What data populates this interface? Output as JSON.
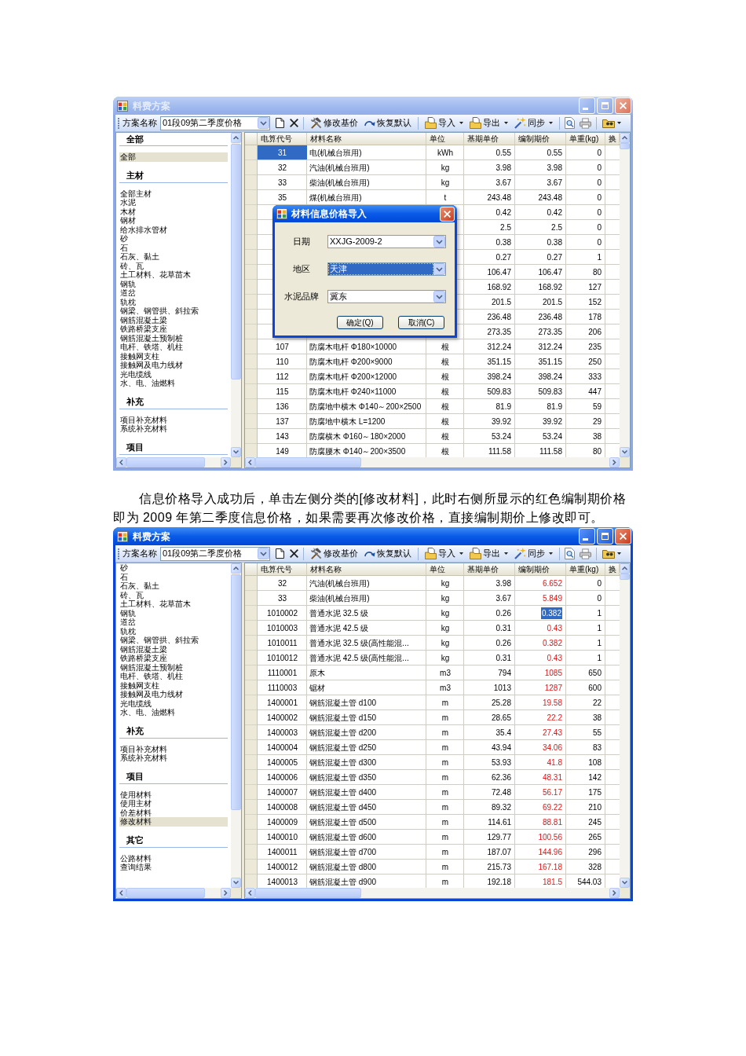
{
  "blocks": [
    {
      "kind": "window",
      "title": "料费方案",
      "active": false,
      "toolbar": {
        "label": "方案名称",
        "scheme": "01段09第二季度价格",
        "buttons": [
          {
            "label": "修改基价",
            "dropdown": false
          },
          {
            "label": "恢复默认",
            "dropdown": false
          },
          {
            "label": "导入",
            "dropdown": true
          },
          {
            "label": "导出",
            "dropdown": true
          },
          {
            "label": "同步",
            "dropdown": true
          }
        ]
      },
      "sidebar": {
        "sections": [
          {
            "title": "全部",
            "items": [
              {
                "label": "全部",
                "selected": true
              }
            ]
          },
          {
            "title": "主材",
            "items": [
              {
                "label": "全部主材",
                "selected": false
              },
              {
                "label": "水泥",
                "selected": false
              },
              {
                "label": "木材",
                "selected": false
              },
              {
                "label": "钢材",
                "selected": false
              },
              {
                "label": "给水排水管材",
                "selected": false
              },
              {
                "label": "砂",
                "selected": false
              },
              {
                "label": "石",
                "selected": false
              },
              {
                "label": "石灰、黏土",
                "selected": false
              },
              {
                "label": "砖、瓦",
                "selected": false
              },
              {
                "label": "土工材料、花草苗木",
                "selected": false
              },
              {
                "label": "钢轨",
                "selected": false
              },
              {
                "label": "道岔",
                "selected": false
              },
              {
                "label": "轨枕",
                "selected": false
              },
              {
                "label": "钢梁、钢管拱、斜拉索",
                "selected": false
              },
              {
                "label": "钢筋混凝土梁",
                "selected": false
              },
              {
                "label": "铁路桥梁支座",
                "selected": false
              },
              {
                "label": "钢筋混凝土预制桩",
                "selected": false
              },
              {
                "label": "电杆、铁塔、机柱",
                "selected": false
              },
              {
                "label": "接触网支柱",
                "selected": false
              },
              {
                "label": "接触网及电力线材",
                "selected": false
              },
              {
                "label": "光电缆线",
                "selected": false
              },
              {
                "label": "水、电、油燃料",
                "selected": false
              }
            ]
          },
          {
            "title": "补充",
            "items": [
              {
                "label": "项目补充材料",
                "selected": false
              },
              {
                "label": "系统补充材料",
                "selected": false
              }
            ]
          },
          {
            "title": "项目"
          }
        ]
      },
      "table": {
        "columns": [
          "电算代号",
          "材料名称",
          "单位",
          "基期单价",
          "编制期价",
          "单重(kg)",
          "换"
        ],
        "editing": false,
        "rows": [
          {
            "code": "31",
            "name": "电(机械台班用)",
            "unit": "kWh",
            "base_price": "0.55",
            "current_price": "0.55",
            "unit_weight": "0",
            "modified": false,
            "code_selected": true,
            "price_selected": false
          },
          {
            "code": "32",
            "name": "汽油(机械台班用)",
            "unit": "kg",
            "base_price": "3.98",
            "current_price": "3.98",
            "unit_weight": "0",
            "modified": false,
            "code_selected": false,
            "price_selected": false
          },
          {
            "code": "33",
            "name": "柴油(机械台班用)",
            "unit": "kg",
            "base_price": "3.67",
            "current_price": "3.67",
            "unit_weight": "0",
            "modified": false,
            "code_selected": false,
            "price_selected": false
          },
          {
            "code": "35",
            "name": "煤(机械台班用)",
            "unit": "t",
            "base_price": "243.48",
            "current_price": "243.48",
            "unit_weight": "0",
            "modified": false,
            "code_selected": false,
            "price_selected": false
          },
          {
            "base_price": "0.42",
            "current_price": "0.42",
            "unit_weight": "0",
            "modified": false,
            "code_selected": false,
            "price_selected": false
          },
          {
            "base_price": "2.5",
            "current_price": "2.5",
            "unit_weight": "0",
            "modified": false,
            "code_selected": false,
            "price_selected": false
          },
          {
            "base_price": "0.38",
            "current_price": "0.38",
            "unit_weight": "0",
            "modified": false,
            "code_selected": false,
            "price_selected": false
          },
          {
            "base_price": "0.27",
            "current_price": "0.27",
            "unit_weight": "1",
            "modified": false,
            "code_selected": false,
            "price_selected": false
          },
          {
            "base_price": "106.47",
            "current_price": "106.47",
            "unit_weight": "80",
            "modified": false,
            "code_selected": false,
            "price_selected": false
          },
          {
            "base_price": "168.92",
            "current_price": "168.92",
            "unit_weight": "127",
            "modified": false,
            "code_selected": false,
            "price_selected": false
          },
          {
            "base_price": "201.5",
            "current_price": "201.5",
            "unit_weight": "152",
            "modified": false,
            "code_selected": false,
            "price_selected": false
          },
          {
            "base_price": "236.48",
            "current_price": "236.48",
            "unit_weight": "178",
            "modified": false,
            "code_selected": false,
            "price_selected": false
          },
          {
            "base_price": "273.35",
            "current_price": "273.35",
            "unit_weight": "206",
            "modified": false,
            "code_selected": false,
            "price_selected": false
          },
          {
            "code": "107",
            "name": "防腐木电杆 Φ180×10000",
            "unit": "根",
            "base_price": "312.24",
            "current_price": "312.24",
            "unit_weight": "235",
            "modified": false,
            "code_selected": false,
            "price_selected": false
          },
          {
            "code": "110",
            "name": "防腐木电杆 Φ200×9000",
            "unit": "根",
            "base_price": "351.15",
            "current_price": "351.15",
            "unit_weight": "250",
            "modified": false,
            "code_selected": false,
            "price_selected": false
          },
          {
            "code": "112",
            "name": "防腐木电杆 Φ200×12000",
            "unit": "根",
            "base_price": "398.24",
            "current_price": "398.24",
            "unit_weight": "333",
            "modified": false,
            "code_selected": false,
            "price_selected": false
          },
          {
            "code": "115",
            "name": "防腐木电杆 Φ240×11000",
            "unit": "根",
            "base_price": "509.83",
            "current_price": "509.83",
            "unit_weight": "447",
            "modified": false,
            "code_selected": false,
            "price_selected": false
          },
          {
            "code": "136",
            "name": "防腐地中横木 Φ140～200×2500",
            "unit": "根",
            "base_price": "81.9",
            "current_price": "81.9",
            "unit_weight": "59",
            "modified": false,
            "code_selected": false,
            "price_selected": false
          },
          {
            "code": "137",
            "name": "防腐地中横木 L=1200",
            "unit": "根",
            "base_price": "39.92",
            "current_price": "39.92",
            "unit_weight": "29",
            "modified": false,
            "code_selected": false,
            "price_selected": false
          },
          {
            "code": "143",
            "name": "防腐横木 Φ160～180×2000",
            "unit": "根",
            "base_price": "53.24",
            "current_price": "53.24",
            "unit_weight": "38",
            "modified": false,
            "code_selected": false,
            "price_selected": false
          },
          {
            "code": "149",
            "name": "防腐腰木 Φ140～200×3500",
            "unit": "根",
            "base_price": "111.58",
            "current_price": "111.58",
            "unit_weight": "80",
            "modified": false,
            "code_selected": false,
            "price_selected": false
          }
        ]
      },
      "dialog": {
        "title": "材料信息价格导入",
        "fields": [
          {
            "label": "日期",
            "value": "XXJG-2009-2",
            "selected": false
          },
          {
            "label": "地区",
            "value": "天津",
            "selected": true
          },
          {
            "label": "水泥品牌",
            "value": "冀东",
            "selected": false
          }
        ],
        "buttons": [
          "确定(Q)",
          "取消(C)"
        ]
      }
    },
    {
      "kind": "paragraph",
      "text": "信息价格导入成功后，单击左侧分类的[修改材料]，此时右侧所显示的红色编制期价格即为 2009 年第二季度信息价格，如果需要再次修改价格，直接编制期价上修改即可。"
    },
    {
      "kind": "window",
      "title": "料费方案",
      "active": true,
      "toolbar": {
        "label": "方案名称",
        "scheme": "01段09第二季度价格",
        "buttons": [
          {
            "label": "修改基价",
            "dropdown": false
          },
          {
            "label": "恢复默认",
            "dropdown": false
          },
          {
            "label": "导入",
            "dropdown": true
          },
          {
            "label": "导出",
            "dropdown": true
          },
          {
            "label": "同步",
            "dropdown": true
          }
        ]
      },
      "sidebar": {
        "sections": [
          {
            "items": [
              {
                "label": "砂",
                "selected": false
              },
              {
                "label": "石",
                "selected": false
              },
              {
                "label": "石灰、黏土",
                "selected": false
              },
              {
                "label": "砖、瓦",
                "selected": false
              },
              {
                "label": "土工材料、花草苗木",
                "selected": false
              },
              {
                "label": "钢轨",
                "selected": false
              },
              {
                "label": "道岔",
                "selected": false
              },
              {
                "label": "轨枕",
                "selected": false
              },
              {
                "label": "钢梁、钢管拱、斜拉索",
                "selected": false
              },
              {
                "label": "钢筋混凝土梁",
                "selected": false
              },
              {
                "label": "铁路桥梁支座",
                "selected": false
              },
              {
                "label": "钢筋混凝土预制桩",
                "selected": false
              },
              {
                "label": "电杆、铁塔、机柱",
                "selected": false
              },
              {
                "label": "接触网支柱",
                "selected": false
              },
              {
                "label": "接触网及电力线材",
                "selected": false
              },
              {
                "label": "光电缆线",
                "selected": false
              },
              {
                "label": "水、电、油燃料",
                "selected": false
              }
            ]
          },
          {
            "title": "补充",
            "items": [
              {
                "label": "项目补充材料",
                "selected": false
              },
              {
                "label": "系统补充材料",
                "selected": false
              }
            ]
          },
          {
            "title": "项目",
            "items": [
              {
                "label": "使用材料",
                "selected": false
              },
              {
                "label": "使用主材",
                "selected": false
              },
              {
                "label": "价差材料",
                "selected": false
              },
              {
                "label": "修改材料",
                "selected": true
              }
            ]
          },
          {
            "title": "其它",
            "items": [
              {
                "label": "公路材料",
                "selected": false
              },
              {
                "label": "查询结果",
                "selected": false
              }
            ]
          }
        ]
      },
      "table": {
        "columns": [
          "电算代号",
          "材料名称",
          "单位",
          "基期单价",
          "编制期价",
          "单重(kg)",
          "换"
        ],
        "editing": true,
        "rows": [
          {
            "code": "32",
            "name": "汽油(机械台班用)",
            "unit": "kg",
            "base_price": "3.98",
            "current_price": "6.652",
            "unit_weight": "0",
            "modified": true,
            "code_selected": false,
            "price_selected": false
          },
          {
            "code": "33",
            "name": "柴油(机械台班用)",
            "unit": "kg",
            "base_price": "3.67",
            "current_price": "5.849",
            "unit_weight": "0",
            "modified": true,
            "code_selected": false,
            "price_selected": false
          },
          {
            "code": "1010002",
            "name": "普通水泥 32.5 级",
            "unit": "kg",
            "base_price": "0.26",
            "current_price": "0.382",
            "unit_weight": "1",
            "modified": true,
            "code_selected": false,
            "price_selected": true
          },
          {
            "code": "1010003",
            "name": "普通水泥 42.5 级",
            "unit": "kg",
            "base_price": "0.31",
            "current_price": "0.43",
            "unit_weight": "1",
            "modified": true,
            "code_selected": false,
            "price_selected": false
          },
          {
            "code": "1010011",
            "name": "普通水泥 32.5 级(高性能混...",
            "unit": "kg",
            "base_price": "0.26",
            "current_price": "0.382",
            "unit_weight": "1",
            "modified": true,
            "code_selected": false,
            "price_selected": false
          },
          {
            "code": "1010012",
            "name": "普通水泥 42.5 级(高性能混...",
            "unit": "kg",
            "base_price": "0.31",
            "current_price": "0.43",
            "unit_weight": "1",
            "modified": true,
            "code_selected": false,
            "price_selected": false
          },
          {
            "code": "1110001",
            "name": "原木",
            "unit": "m3",
            "base_price": "794",
            "current_price": "1085",
            "unit_weight": "650",
            "modified": true,
            "code_selected": false,
            "price_selected": false
          },
          {
            "code": "1110003",
            "name": "锯材",
            "unit": "m3",
            "base_price": "1013",
            "current_price": "1287",
            "unit_weight": "600",
            "modified": true,
            "code_selected": false,
            "price_selected": false
          },
          {
            "code": "1400001",
            "name": "钢筋混凝土管 d100",
            "unit": "m",
            "base_price": "25.28",
            "current_price": "19.58",
            "unit_weight": "22",
            "modified": true,
            "code_selected": false,
            "price_selected": false
          },
          {
            "code": "1400002",
            "name": "钢筋混凝土管 d150",
            "unit": "m",
            "base_price": "28.65",
            "current_price": "22.2",
            "unit_weight": "38",
            "modified": true,
            "code_selected": false,
            "price_selected": false
          },
          {
            "code": "1400003",
            "name": "钢筋混凝土管 d200",
            "unit": "m",
            "base_price": "35.4",
            "current_price": "27.43",
            "unit_weight": "55",
            "modified": true,
            "code_selected": false,
            "price_selected": false
          },
          {
            "code": "1400004",
            "name": "钢筋混凝土管 d250",
            "unit": "m",
            "base_price": "43.94",
            "current_price": "34.06",
            "unit_weight": "83",
            "modified": true,
            "code_selected": false,
            "price_selected": false
          },
          {
            "code": "1400005",
            "name": "钢筋混凝土管 d300",
            "unit": "m",
            "base_price": "53.93",
            "current_price": "41.8",
            "unit_weight": "108",
            "modified": true,
            "code_selected": false,
            "price_selected": false
          },
          {
            "code": "1400006",
            "name": "钢筋混凝土管 d350",
            "unit": "m",
            "base_price": "62.36",
            "current_price": "48.31",
            "unit_weight": "142",
            "modified": true,
            "code_selected": false,
            "price_selected": false
          },
          {
            "code": "1400007",
            "name": "钢筋混凝土管 d400",
            "unit": "m",
            "base_price": "72.48",
            "current_price": "56.17",
            "unit_weight": "175",
            "modified": true,
            "code_selected": false,
            "price_selected": false
          },
          {
            "code": "1400008",
            "name": "钢筋混凝土管 d450",
            "unit": "m",
            "base_price": "89.32",
            "current_price": "69.22",
            "unit_weight": "210",
            "modified": true,
            "code_selected": false,
            "price_selected": false
          },
          {
            "code": "1400009",
            "name": "钢筋混凝土管 d500",
            "unit": "m",
            "base_price": "114.61",
            "current_price": "88.81",
            "unit_weight": "245",
            "modified": true,
            "code_selected": false,
            "price_selected": false
          },
          {
            "code": "1400010",
            "name": "钢筋混凝土管 d600",
            "unit": "m",
            "base_price": "129.77",
            "current_price": "100.56",
            "unit_weight": "265",
            "modified": true,
            "code_selected": false,
            "price_selected": false
          },
          {
            "code": "1400011",
            "name": "钢筋混凝土管 d700",
            "unit": "m",
            "base_price": "187.07",
            "current_price": "144.96",
            "unit_weight": "296",
            "modified": true,
            "code_selected": false,
            "price_selected": false
          },
          {
            "code": "1400012",
            "name": "钢筋混凝土管 d800",
            "unit": "m",
            "base_price": "215.73",
            "current_price": "167.18",
            "unit_weight": "328",
            "modified": true,
            "code_selected": false,
            "price_selected": false
          },
          {
            "code": "1400013",
            "name": "钢筋混凝土管 d900",
            "unit": "m",
            "base_price": "192.18",
            "current_price": "181.5",
            "unit_weight": "544.03",
            "modified": true,
            "code_selected": false,
            "price_selected": false
          }
        ]
      }
    }
  ]
}
